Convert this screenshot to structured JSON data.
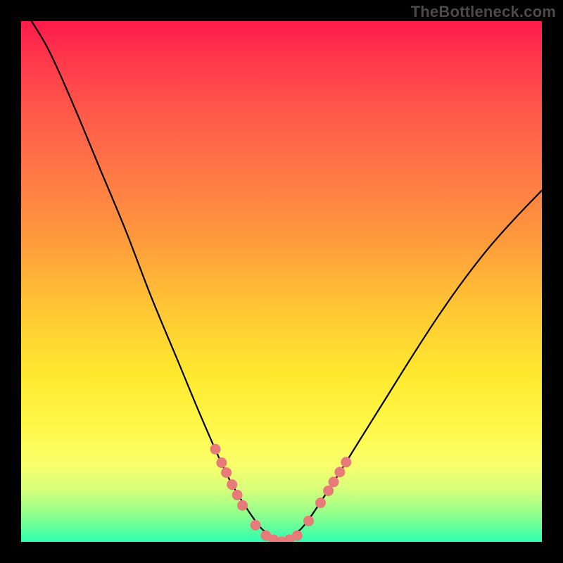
{
  "watermark": "TheBottleneck.com",
  "colors": {
    "curve_stroke": "#000000",
    "marker_fill": "#e77b79",
    "marker_stroke": "#e77b79"
  },
  "chart_data": {
    "type": "line",
    "title": "",
    "xlabel": "",
    "ylabel": "",
    "x": [
      0.0,
      0.05,
      0.1,
      0.15,
      0.2,
      0.25,
      0.3,
      0.35,
      0.4,
      0.45,
      0.475,
      0.5,
      0.525,
      0.55,
      0.6,
      0.65,
      0.7,
      0.75,
      0.8,
      0.85,
      0.9,
      0.95,
      1.0
    ],
    "values": [
      1.03,
      0.95,
      0.84,
      0.72,
      0.6,
      0.47,
      0.35,
      0.23,
      0.12,
      0.04,
      0.015,
      0.0,
      0.015,
      0.04,
      0.115,
      0.195,
      0.275,
      0.355,
      0.432,
      0.503,
      0.567,
      0.623,
      0.675
    ],
    "xlim": [
      0,
      1
    ],
    "ylim": [
      0,
      1
    ],
    "markers": {
      "x": [
        0.373,
        0.385,
        0.394,
        0.405,
        0.415,
        0.425,
        0.45,
        0.47,
        0.485,
        0.5,
        0.515,
        0.53,
        0.552,
        0.575,
        0.59,
        0.6,
        0.612,
        0.624
      ],
      "y": [
        0.178,
        0.152,
        0.133,
        0.11,
        0.09,
        0.07,
        0.032,
        0.012,
        0.004,
        0.0,
        0.004,
        0.012,
        0.04,
        0.075,
        0.098,
        0.115,
        0.134,
        0.153
      ]
    }
  }
}
